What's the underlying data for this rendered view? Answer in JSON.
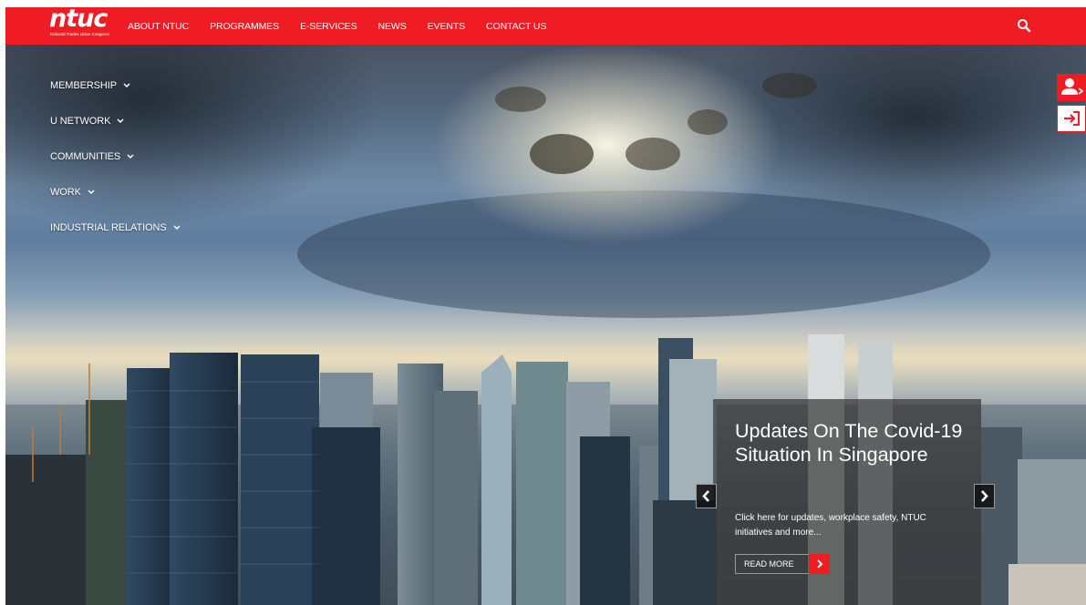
{
  "brand": {
    "logo_text": "ntuc",
    "logo_subtitle": "National Trades Union Congress"
  },
  "nav": {
    "items": [
      {
        "label": "ABOUT NTUC"
      },
      {
        "label": "PROGRAMMES"
      },
      {
        "label": "E-SERVICES"
      },
      {
        "label": "NEWS"
      },
      {
        "label": "EVENTS"
      },
      {
        "label": "CONTACT US"
      }
    ],
    "search_icon": "search-icon"
  },
  "side_menu": {
    "items": [
      {
        "label": "MEMBERSHIP"
      },
      {
        "label": "U NETWORK"
      },
      {
        "label": "COMMUNITIES"
      },
      {
        "label": "WORK"
      },
      {
        "label": "INDUSTRIAL RELATIONS"
      }
    ]
  },
  "floating_buttons": {
    "top_icon": "user-icon",
    "bottom_icon": "login-icon"
  },
  "slide": {
    "title": "Updates On The Covid-19 Situation In Singapore",
    "text": "Click here for updates, workplace safety, NTUC initiatives and more...",
    "read_more": "READ MORE"
  },
  "colors": {
    "brand_red": "#ef1c23",
    "caption_bg": "#373737"
  }
}
